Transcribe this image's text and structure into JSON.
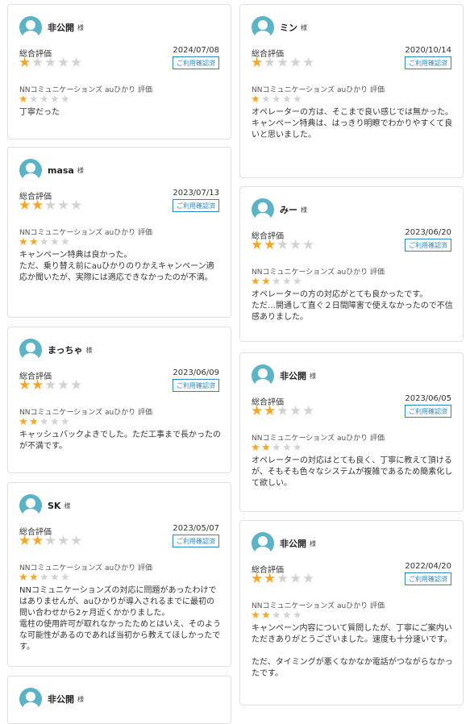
{
  "reviews": [
    {
      "col": "left",
      "name": "非公開",
      "honorific": "様",
      "overall_label": "総合評価",
      "date": "2024/07/08",
      "overall_stars": 1,
      "badge": "ご利用確認済",
      "service_label": "NNコミュニケーションズ auひかり 評価",
      "service_stars": 1,
      "text": "丁寧だった"
    },
    {
      "col": "left",
      "name": "masa",
      "honorific": "様",
      "overall_label": "総合評価",
      "date": "2023/07/13",
      "overall_stars": 2,
      "badge": "ご利用確認済",
      "service_label": "NNコミュニケーションズ auひかり 評価",
      "service_stars": 2,
      "text": "キャンペーン特典は良かった。\nただ、乗り替え前にauひかりのりかえキャンペーン適応か聞いたが、実際には適応できなかったのが不満。"
    },
    {
      "col": "left",
      "name": "まっちゃ",
      "honorific": "様",
      "overall_label": "総合評価",
      "date": "2023/06/09",
      "overall_stars": 2,
      "badge": "ご利用確認済",
      "service_label": "NNコミュニケーションズ auひかり 評価",
      "service_stars": 2,
      "text": "キャッシュバックよきでした。ただ工事まで長かったのが不満です。"
    },
    {
      "col": "left",
      "name": "SK",
      "honorific": "様",
      "overall_label": "総合評価",
      "date": "2023/05/07",
      "overall_stars": 2,
      "badge": "ご利用確認済",
      "service_label": "NNコミュニケーションズ auひかり 評価",
      "service_stars": 2,
      "text": "NNコミュニケーションズの対応に問題があったわけではありませんが、auひかりが導入されるまでに最初の問い合わせから2ヶ月近くかかりました。\n電柱の使用許可が取れなかったためとはいえ、そのような可能性があるのであれば当初から教えてほしかったです。"
    },
    {
      "col": "left",
      "name": "非公開",
      "honorific": "様",
      "overall_label": "",
      "date": "",
      "overall_stars": 0,
      "badge": "",
      "service_label": "",
      "service_stars": 0,
      "text": ""
    },
    {
      "col": "right",
      "name": "ミン",
      "honorific": "様",
      "overall_label": "総合評価",
      "date": "2020/10/14",
      "overall_stars": 1,
      "badge": "ご利用確認済",
      "service_label": "NNコミュニケーションズ auひかり 評価",
      "service_stars": 1,
      "text": "オペレーターの方は、そこまで良い感じでは無かった。\nキャンペーン特典は、はっきり明瞭でわかりやすくて良いと思いました。"
    },
    {
      "col": "right",
      "name": "みー",
      "honorific": "様",
      "overall_label": "総合評価",
      "date": "2023/06/20",
      "overall_stars": 2,
      "badge": "ご利用確認済",
      "service_label": "NNコミュニケーションズ auひかり 評価",
      "service_stars": 2,
      "text": "オペレーターの方の対応がとても良かったです。\nただ…開通して直ぐ２日間障害で使えなかったので不信感ありました。"
    },
    {
      "col": "right",
      "name": "非公開",
      "honorific": "様",
      "overall_label": "総合評価",
      "date": "2023/06/05",
      "overall_stars": 2,
      "badge": "ご利用確認済",
      "service_label": "NNコミュニケーションズ auひかり 評価",
      "service_stars": 2,
      "text": "オペレーターの対応はとても良く、丁寧に教えて頂けるが、そもそも色々なシステムが複雑であるため簡素化して欲しい。"
    },
    {
      "col": "right",
      "name": "非公開",
      "honorific": "様",
      "overall_label": "総合評価",
      "date": "2022/04/20",
      "overall_stars": 2,
      "badge": "ご利用確認済",
      "service_label": "NNコミュニケーションズ auひかり 評価",
      "service_stars": 2,
      "text": "キャンペーン内容について質問したが、丁寧にご案内いただきありがとうございました。速度も十分速いです。\n\nただ、タイミングが悪くなかなか電話がつながらなかったです。"
    }
  ]
}
